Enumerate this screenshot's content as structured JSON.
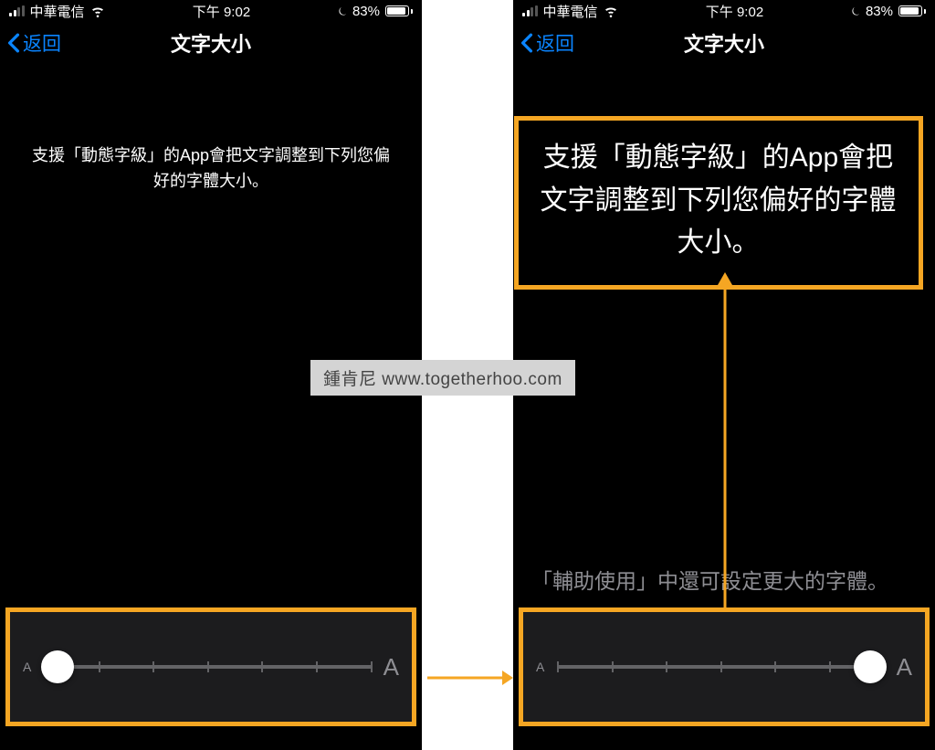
{
  "status": {
    "carrier": "中華電信",
    "time": "下午 9:02",
    "battery_pct": "83%"
  },
  "nav": {
    "back": "返回",
    "title": "文字大小"
  },
  "left": {
    "description": "支援「動態字級」的App會把文字調整到下列您偏好的字體大小。"
  },
  "right": {
    "description": "支援「動態字級」的App會把文字調整到下列您偏好的字體大小。",
    "aux": "「輔助使用」中還可設定更大的字體。"
  },
  "slider": {
    "small_label": "A",
    "large_label": "A"
  },
  "watermark": "鍾肯尼  www.togetherhoo.com"
}
